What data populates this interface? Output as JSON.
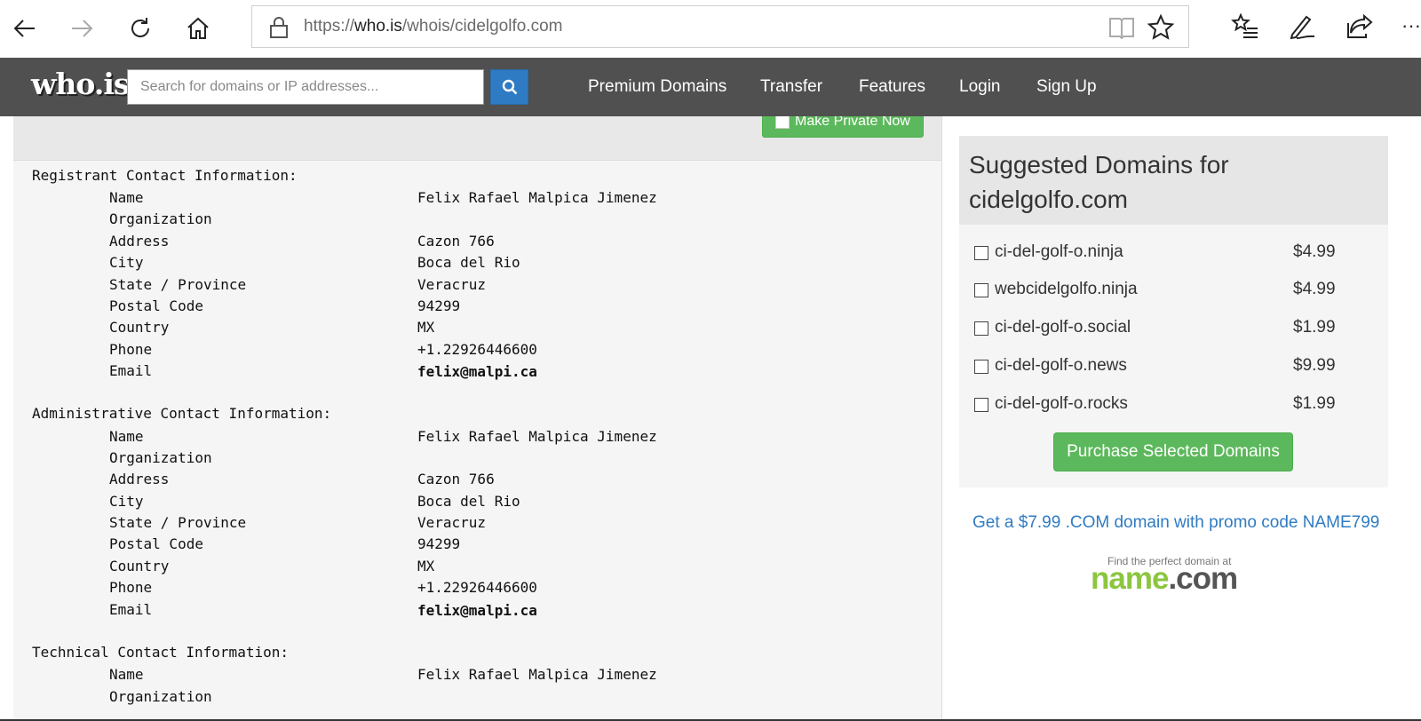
{
  "browser": {
    "url_prefix": "https://",
    "url_host": "who.is",
    "url_path": "/whois/cidelgolfo.com",
    "more_label": "···"
  },
  "header": {
    "logo": "who.is",
    "search_placeholder": "Search for domains or IP addresses...",
    "nav": [
      "Premium Domains",
      "Transfer",
      "Features",
      "Login",
      "Sign Up"
    ]
  },
  "privacy_button": "Make Private Now",
  "whois": {
    "sections": [
      {
        "title": "Registrant Contact Information:",
        "rows": [
          {
            "label": "Name",
            "value": "Felix Rafael Malpica Jimenez"
          },
          {
            "label": "Organization",
            "value": ""
          },
          {
            "label": "Address",
            "value": "Cazon 766"
          },
          {
            "label": "City",
            "value": "Boca del Rio"
          },
          {
            "label": "State / Province",
            "value": "Veracruz"
          },
          {
            "label": "Postal Code",
            "value": "94299"
          },
          {
            "label": "Country",
            "value": "MX"
          },
          {
            "label": "Phone",
            "value": "+1.22926446600"
          },
          {
            "label": "Email",
            "value": "felix@malpi.ca"
          }
        ]
      },
      {
        "title": "Administrative Contact Information:",
        "rows": [
          {
            "label": "Name",
            "value": "Felix Rafael Malpica Jimenez"
          },
          {
            "label": "Organization",
            "value": ""
          },
          {
            "label": "Address",
            "value": "Cazon 766"
          },
          {
            "label": "City",
            "value": "Boca del Rio"
          },
          {
            "label": "State / Province",
            "value": "Veracruz"
          },
          {
            "label": "Postal Code",
            "value": "94299"
          },
          {
            "label": "Country",
            "value": "MX"
          },
          {
            "label": "Phone",
            "value": "+1.22926446600"
          },
          {
            "label": "Email",
            "value": "felix@malpi.ca"
          }
        ]
      },
      {
        "title": "Technical Contact Information:",
        "rows": [
          {
            "label": "Name",
            "value": "Felix Rafael Malpica Jimenez"
          },
          {
            "label": "Organization",
            "value": ""
          }
        ]
      }
    ]
  },
  "suggestions": {
    "title": "Suggested Domains for cidelgolfo.com",
    "items": [
      {
        "domain": "ci-del-golf-o.ninja",
        "price": "$4.99"
      },
      {
        "domain": "webcidelgolfo.ninja",
        "price": "$4.99"
      },
      {
        "domain": "ci-del-golf-o.social",
        "price": "$1.99"
      },
      {
        "domain": "ci-del-golf-o.news",
        "price": "$9.99"
      },
      {
        "domain": "ci-del-golf-o.rocks",
        "price": "$1.99"
      }
    ],
    "button": "Purchase Selected Domains"
  },
  "promo": "Get a $7.99 .COM domain with promo code NAME799",
  "namecom": {
    "tagline": "Find the perfect domain at",
    "brand_left": "name",
    "brand_dot": ".",
    "brand_right": "com"
  },
  "colors": {
    "header_bg": "#505050",
    "accent_blue": "#2f7bc3",
    "button_green": "#5cb85c"
  }
}
